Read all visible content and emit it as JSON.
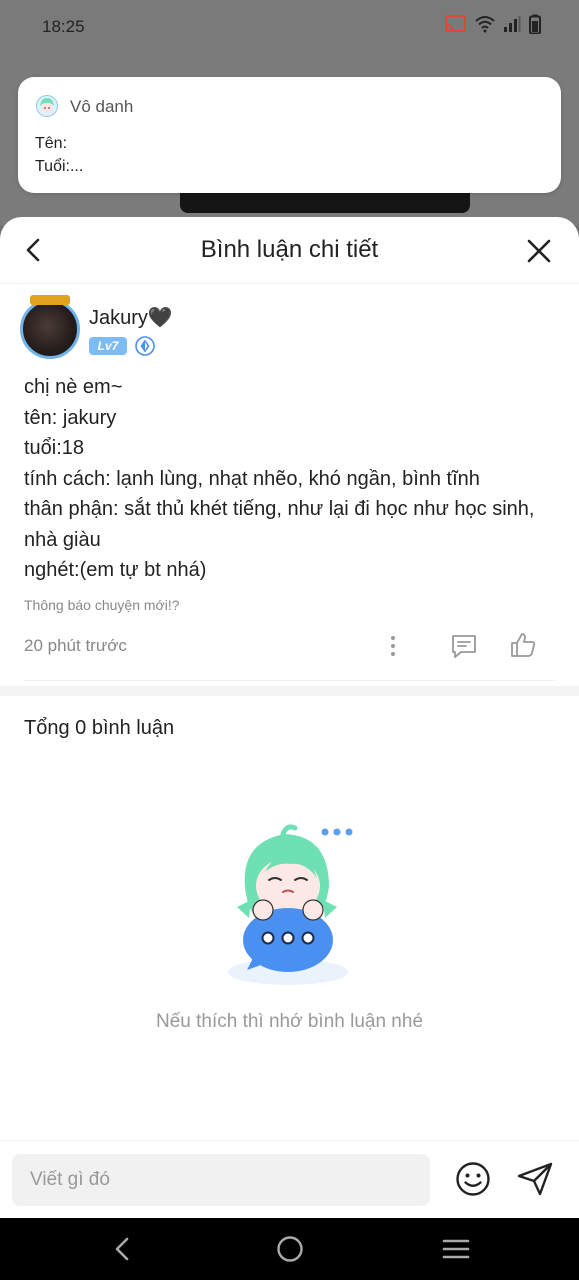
{
  "status_bar": {
    "time": "18:25"
  },
  "notification": {
    "name": "Vô danh",
    "lines": [
      "Tên:",
      "Tuổi:..."
    ]
  },
  "sheet": {
    "title": "Bình luận chi tiết"
  },
  "post": {
    "author": "Jakury🖤",
    "level": "Lv7",
    "lines": [
      "chị nè em~",
      "tên: jakury",
      "tuổi:18",
      "tính cách: lạnh lùng, nhạt nhẽo, khó ngần, bình tĩnh",
      "thân phận: sắt thủ khét tiếng, như lại đi học như học sinh,",
      "nhà giàu",
      "nghét:(em tự bt nhá)"
    ],
    "note": "Thông báo chuyện mới!?",
    "time": "20 phút trước"
  },
  "comments": {
    "total_label": "Tổng 0 bình luận",
    "empty_text": "Nếu thích thì nhớ bình luận nhé"
  },
  "input": {
    "placeholder": "Viết gì đó"
  },
  "colors": {
    "accent_blue": "#7dbbf3",
    "mascot_hair": "#6fe0b3",
    "mascot_bubble": "#4a90f0"
  }
}
